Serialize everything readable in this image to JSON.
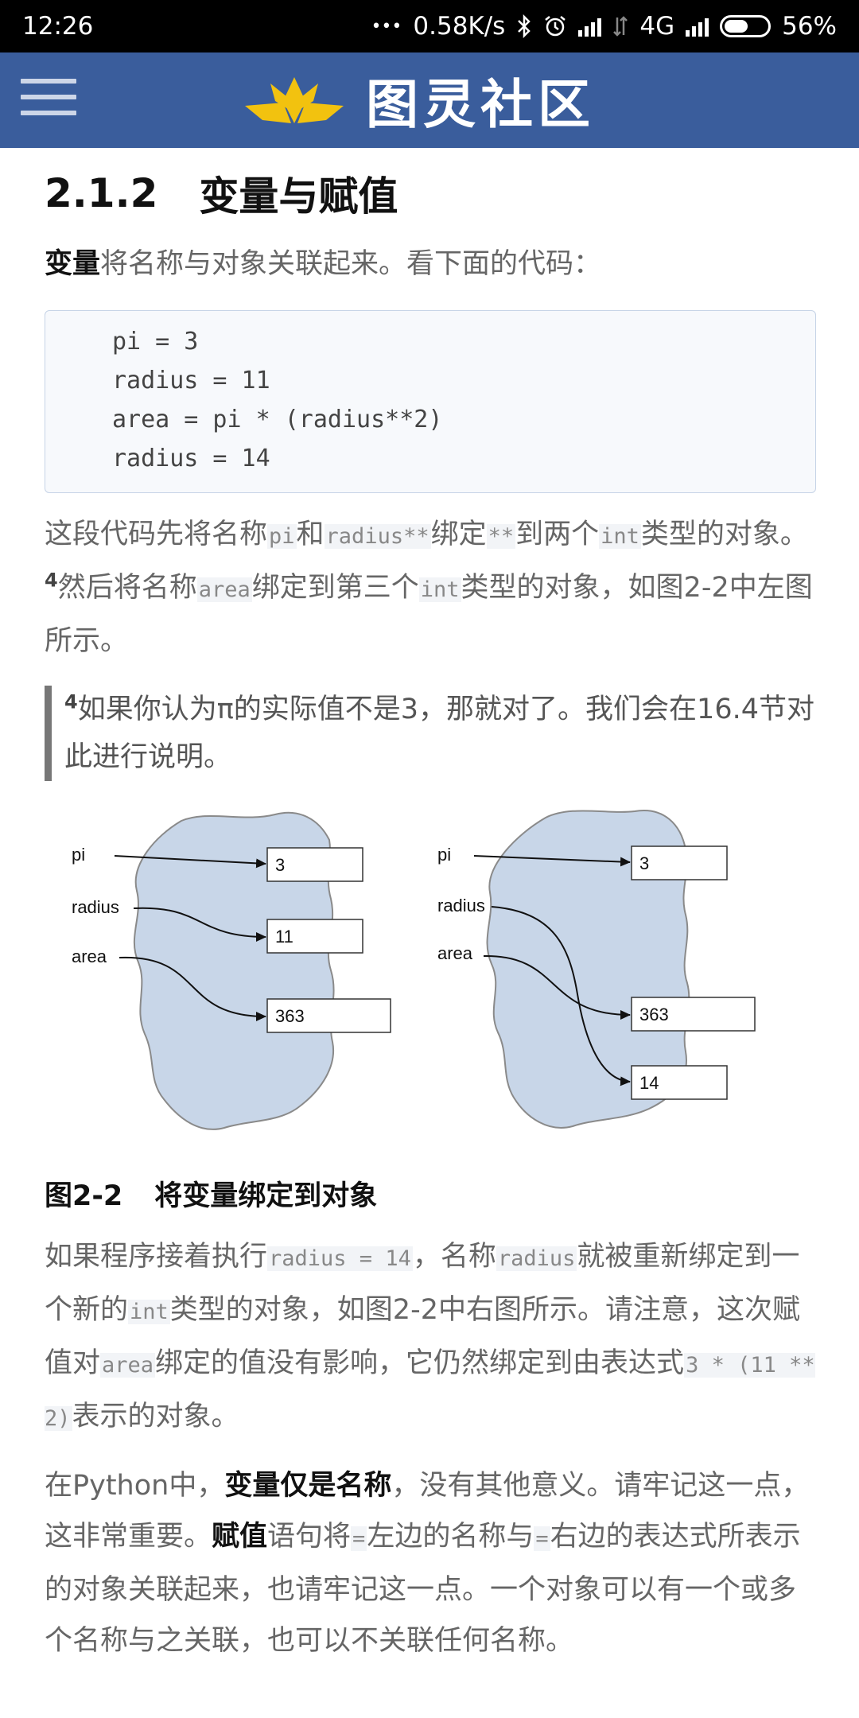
{
  "status_bar": {
    "time": "12:26",
    "dots": "•••",
    "net_speed": "0.58K/s",
    "network": "4G",
    "battery": "56%",
    "battery_level": 0.56
  },
  "header": {
    "brand": "图灵社区"
  },
  "section": {
    "number": "2.1.2",
    "title": "变量与赋值"
  },
  "para1": {
    "bold": "变量",
    "rest": "将名称与对象关联起来。看下面的代码："
  },
  "code": [
    "pi = 3",
    "radius = 11",
    "area = pi * (radius**2)",
    "radius = 14"
  ],
  "para2": {
    "t1": "这段代码先将名称",
    "c1": "pi",
    "t2": "和",
    "c2": "radius**",
    "t3": "绑定",
    "c3": "**",
    "t4": "到两个",
    "c4": "int",
    "t5": "类型的对象。",
    "fn": "4",
    "t6": "然后将名称",
    "c5": "area",
    "t7": "绑定到第三个",
    "c6": "int",
    "t8": "类型的对象，如图2-2中左图所示。"
  },
  "footnote": {
    "num": "4",
    "text": "如果你认为π的实际值不是3，那就对了。我们会在16.4节对此进行说明。"
  },
  "figure": {
    "left": {
      "labels": [
        "pi",
        "radius",
        "area"
      ],
      "boxes": [
        "3",
        "11",
        "363"
      ]
    },
    "right": {
      "labels": [
        "pi",
        "radius",
        "area"
      ],
      "boxes": [
        "3",
        "363",
        "14"
      ]
    },
    "caption_label": "图2-2",
    "caption_text": "将变量绑定到对象"
  },
  "para3": {
    "t1": "如果程序接着执行",
    "c1": "radius = 14",
    "t2": "，名称",
    "c2": "radius",
    "t3": "就被重新绑定到一个新的",
    "c3": "int",
    "t4": "类型的对象，如图2-2中右图所示。请注意，这次赋值对",
    "c4": "area",
    "t5": "绑定的值没有影响，它仍然绑定到由表达式",
    "c5": "3 * (11 ** 2)",
    "t6": "表示的对象。"
  },
  "para4": {
    "t1": "在Python中，",
    "b1": "变量仅是名称",
    "t2": "，没有其他意义。请牢记这一点，这非常重要。",
    "b2": "赋值",
    "t3": "语句将",
    "c1": "=",
    "t4": "左边的名称与",
    "c2": "=",
    "t5": "右边的表达式所表示的对象关联起来，也请牢记这一点。一个对象可以有一个或多个名称与之关联，也可以不关联任何名称。"
  },
  "colors": {
    "header_bg": "#3a5d9c",
    "logo_yellow": "#f2c20f",
    "cloud_fill": "#c8d6e8"
  }
}
